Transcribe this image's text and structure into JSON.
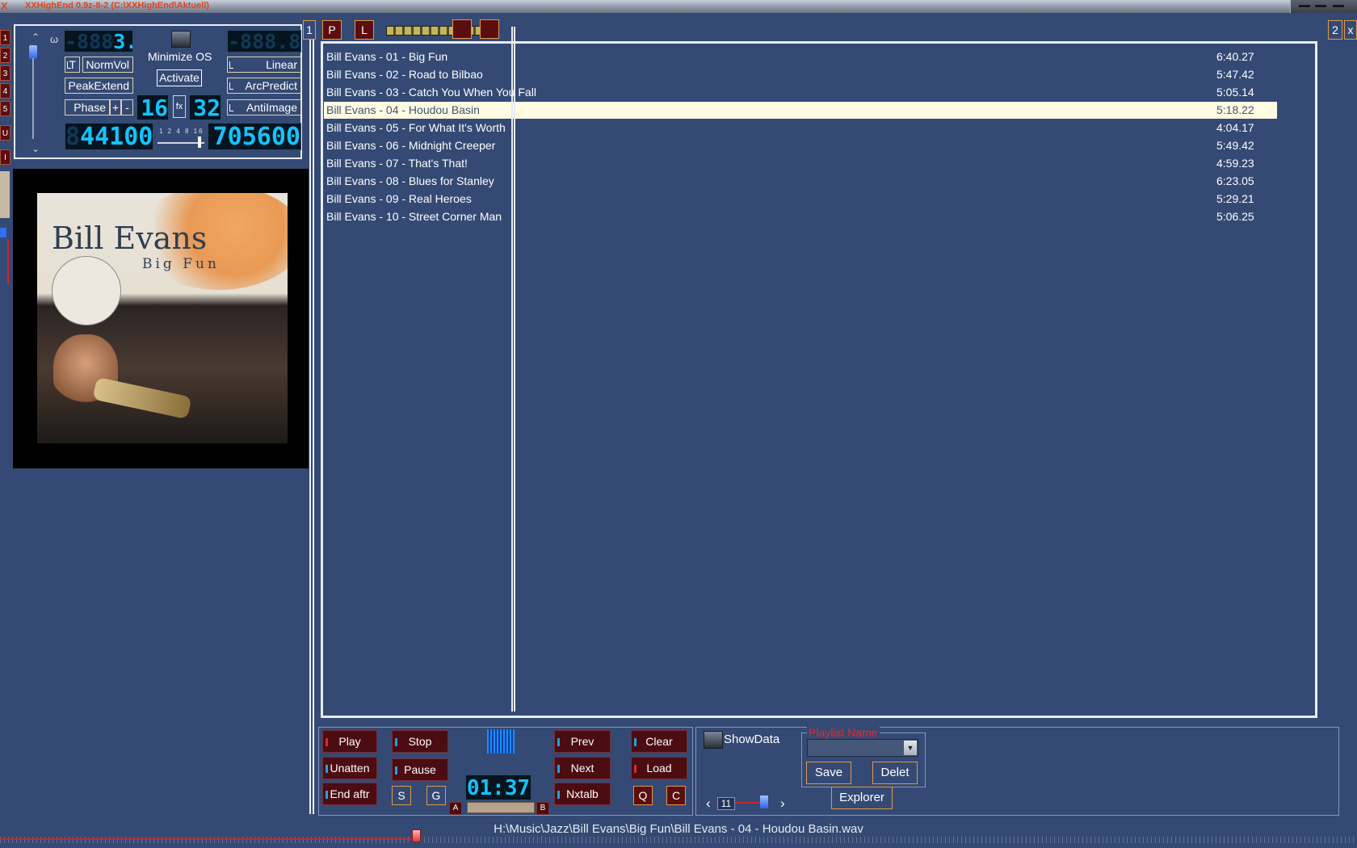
{
  "titlebar": {
    "logo": "X",
    "title": "XXHighEnd 0.9z-8-2 (C:\\XXHighEnd\\Aktuell)"
  },
  "left_numbers": [
    "1",
    "2",
    "3",
    "4",
    "5",
    "U",
    "I"
  ],
  "panel": {
    "top_lcd_1": "3.0",
    "top_lcd_1_ghost": "-888",
    "top_lcd_2_ghost": "-888.8",
    "sigma_label": "ω",
    "t_label": "T",
    "normvol": "NormVol",
    "minimize_os": "Minimize OS",
    "activate": "Activate",
    "linear": "Linear",
    "peakextend": "PeakExtend",
    "arcpredict": "ArcPredict",
    "phase": "Phase",
    "plus": "+",
    "minus": "-",
    "bits_lcd": "16",
    "fx": "fx",
    "bits2_lcd": "32",
    "antiimage": "AntiImage",
    "rate_lcd": "44100",
    "rate_lcd_ghost": "8",
    "ticks": "1 2 4 8 16",
    "rate2_lcd": "705600"
  },
  "cover": {
    "artist": "Bill Evans",
    "album": "Big Fun"
  },
  "tabs": {
    "one": "1",
    "p": "P",
    "l": "L",
    "two": "2",
    "close": "x"
  },
  "playlist": [
    {
      "title": "Bill Evans - 01 - Big Fun",
      "duration": "6:40.27"
    },
    {
      "title": "Bill Evans - 02 - Road to Bilbao",
      "duration": "5:47.42"
    },
    {
      "title": "Bill Evans - 03 - Catch You When You Fall",
      "duration": "5:05.14"
    },
    {
      "title": "Bill Evans - 04 - Houdou Basin",
      "duration": "5:18.22"
    },
    {
      "title": "Bill Evans - 05 - For What It's Worth",
      "duration": "4:04.17"
    },
    {
      "title": "Bill Evans - 06 - Midnight Creeper",
      "duration": "5:49.42"
    },
    {
      "title": "Bill Evans - 07 - That's That!",
      "duration": "4:59.23"
    },
    {
      "title": "Bill Evans - 08 - Blues for Stanley",
      "duration": "6:23.05"
    },
    {
      "title": "Bill Evans - 09 - Real Heroes",
      "duration": "5:29.21"
    },
    {
      "title": "Bill Evans - 10 - Street Corner Man",
      "duration": "5:06.25"
    }
  ],
  "selected_index": 3,
  "transport": {
    "play": "Play",
    "stop": "Stop",
    "prev": "Prev",
    "clear": "Clear",
    "unatten": "Unatten",
    "pause": "Pause",
    "next": "Next",
    "load": "Load",
    "end_aftr": "End aftr",
    "s": "S",
    "g": "G",
    "nxtalb": "Nxtalb",
    "q": "Q",
    "c": "C",
    "time_lcd": "01:37",
    "a": "A",
    "b": "B"
  },
  "data_panel": {
    "showdata": "ShowData",
    "playlist_name_label": "Playlist Name",
    "playlist_name_value": "",
    "save": "Save",
    "delete": "Delet",
    "explorer": "Explorer",
    "pager_value": "11",
    "prev_arrow": "‹",
    "next_arrow": "›"
  },
  "status": {
    "filepath": "H:\\Music\\Jazz\\Bill Evans\\Big Fun\\Bill Evans - 04 - Houdou Basin.wav",
    "progress": 0.307
  },
  "colors": {
    "background": "#344a74",
    "selected_row": "#fffbe3",
    "button_dark": "#4b0c12",
    "accent_orange": "#e0984a",
    "lcd": "#12c4ff"
  }
}
